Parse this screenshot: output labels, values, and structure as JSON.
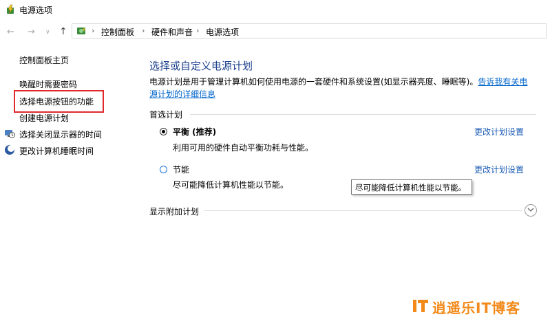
{
  "window": {
    "title": "电源选项"
  },
  "nav": {
    "back_glyph": "←",
    "forward_glyph": "→",
    "recent_glyph": "∨",
    "up_glyph": "↑",
    "separator": "›",
    "breadcrumbs": [
      "控制面板",
      "硬件和声音",
      "电源选项"
    ]
  },
  "sidebar": {
    "home": "控制面板主页",
    "items": [
      {
        "label": "唤醒时需要密码"
      },
      {
        "label": "选择电源按钮的功能"
      },
      {
        "label": "创建电源计划"
      },
      {
        "label": "选择关闭显示器的时间"
      },
      {
        "label": "更改计算机睡眠时间"
      }
    ]
  },
  "main": {
    "heading": "选择或自定义电源计划",
    "description": "电源计划是用于管理计算机如何使用电源的一套硬件和系统设置(如显示器亮度、睡眠等)。",
    "description_link": "告诉我有关电源计划的详细信息",
    "preferred_label": "首选计划",
    "plans": [
      {
        "name": "平衡 (推荐)",
        "description": "利用可用的硬件自动平衡功耗与性能。",
        "change_label": "更改计划设置",
        "selected": true
      },
      {
        "name": "节能",
        "description": "尽可能降低计算机性能以节能。",
        "change_label": "更改计划设置",
        "selected": false
      }
    ],
    "tooltip": "尽可能降低计算机性能以节能。",
    "extra_label": "显示附加计划"
  },
  "watermark": {
    "text": "逍遥乐IT博客"
  },
  "colors": {
    "heading": "#1a3e8c",
    "link": "#0066cc",
    "highlight": "#e0282d",
    "watermark": "#f28a1b"
  }
}
